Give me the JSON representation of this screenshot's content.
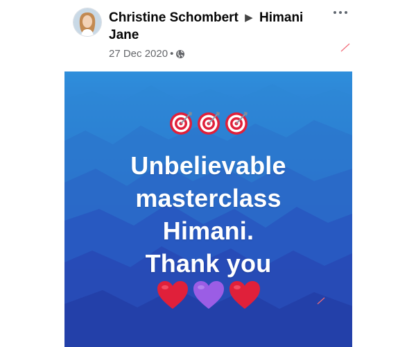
{
  "post": {
    "author": "Christine Schombert",
    "arrow": "▶",
    "recipient": "Himani Jane",
    "date": "27 Dec 2020",
    "separator": "•",
    "privacy_icon": "globe-icon",
    "more_icon": "more-options-icon"
  },
  "image": {
    "top_emojis": [
      "target-icon",
      "target-icon",
      "target-icon"
    ],
    "lines": [
      "Unbelievable",
      "masterclass",
      "Himani.",
      "Thank you"
    ],
    "bottom_emojis": [
      "red-heart-icon",
      "purple-heart-icon",
      "red-heart-icon"
    ]
  },
  "colors": {
    "background_top": "#2f8edb",
    "background_bottom": "#2540ad",
    "text": "#ffffff",
    "red_heart": "#e0203a",
    "purple_heart": "#9b5de5"
  }
}
